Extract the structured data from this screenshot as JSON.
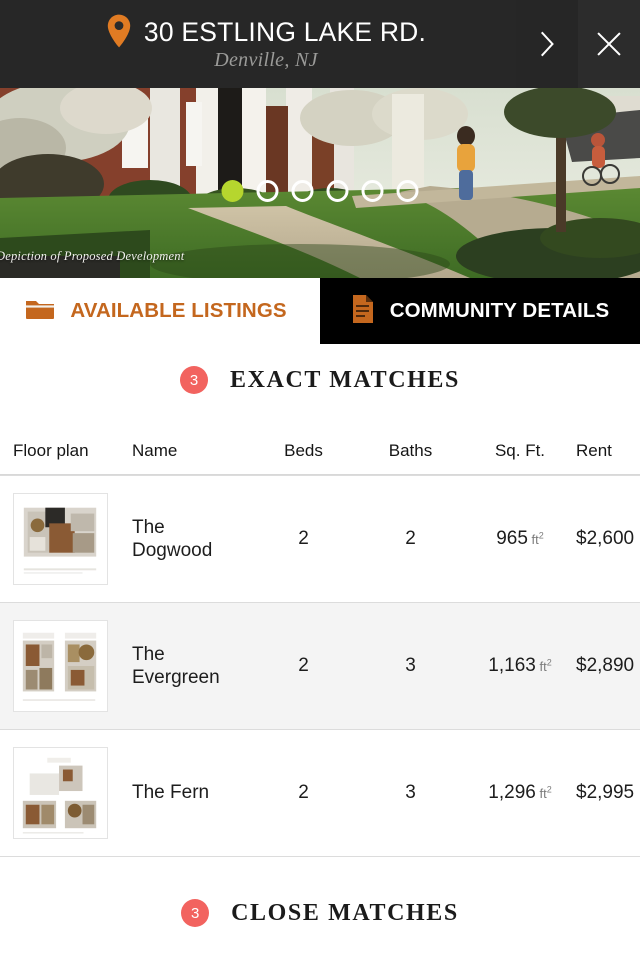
{
  "header": {
    "pin_icon": "map-pin-icon",
    "address": "30 ESTLING LAKE RD.",
    "city_state": "Denville, NJ",
    "next_icon": "chevron-right-icon",
    "close_icon": "close-icon"
  },
  "hero": {
    "caption": "Depiction of Proposed Development",
    "dots_total": 6,
    "active_dot": 1,
    "active_dot_color": "#b6d62e"
  },
  "tabs": [
    {
      "label": "AVAILABLE LISTINGS",
      "icon": "folder-icon",
      "active": true,
      "color": "#c4671e"
    },
    {
      "label": "COMMUNITY DETAILS",
      "icon": "document-icon",
      "active": false,
      "color": "#ffffff"
    }
  ],
  "exact_matches": {
    "count": "3",
    "title": "EXACT MATCHES",
    "badge_color": "#f2635f"
  },
  "close_matches": {
    "count": "3",
    "title": "CLOSE MATCHES",
    "badge_color": "#f2635f"
  },
  "table": {
    "columns": [
      "Floor plan",
      "Name",
      "Beds",
      "Baths",
      "Sq. Ft.",
      "Rent"
    ],
    "unit": "ft",
    "unit_exponent": "2",
    "rows": [
      {
        "plan": "floor-plan-thumbnail",
        "name": "The Dogwood",
        "beds": "2",
        "baths": "2",
        "sqft": "965",
        "rent": "$2,600"
      },
      {
        "plan": "floor-plan-thumbnail",
        "name": "The Evergreen",
        "beds": "2",
        "baths": "3",
        "sqft": "1,163",
        "rent": "$2,890"
      },
      {
        "plan": "floor-plan-thumbnail",
        "name": "The Fern",
        "beds": "2",
        "baths": "3",
        "sqft": "1,296",
        "rent": "$2,995"
      }
    ]
  }
}
